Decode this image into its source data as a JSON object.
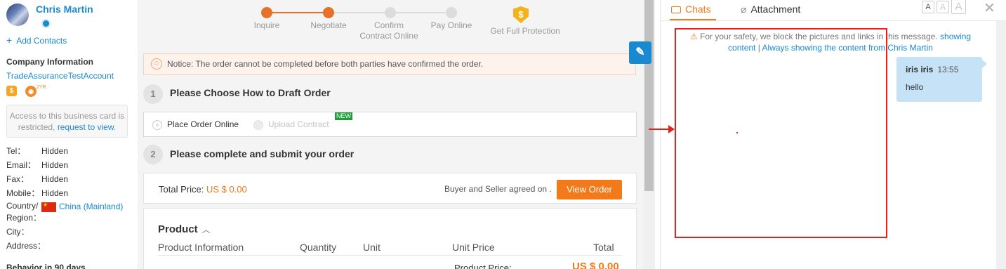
{
  "contact": {
    "name": "Chris Martin",
    "add_contacts": "Add Contacts",
    "company_heading": "Company Information",
    "company_name": "TradeAssuranceTestAccount",
    "years_badge": "2YR",
    "restricted_text": "Access to this business card is restricted,",
    "restricted_link": "request to view",
    "restricted_end": ".",
    "fields": [
      {
        "key": "Tel：",
        "value": "Hidden"
      },
      {
        "key": "Email：",
        "value": "Hidden"
      },
      {
        "key": "Fax：",
        "value": "Hidden"
      },
      {
        "key": "Mobile：",
        "value": "Hidden"
      }
    ],
    "country_key_1": "Country/",
    "country_key_2": "Region：",
    "country_value": "China (Mainland)",
    "city_key": "City：",
    "address_key": "Address：",
    "behavior": "Behavior in 90 days"
  },
  "steps": [
    {
      "label": "Inquire",
      "state": "done"
    },
    {
      "label": "Negotiate",
      "state": "done"
    },
    {
      "label": "Confirm\nContract Online",
      "state": "todo"
    },
    {
      "label": "Pay Online",
      "state": "todo"
    },
    {
      "label": "Get Full Protection",
      "state": "todo"
    }
  ],
  "shield_symbol": "$",
  "notice": "Notice: The order cannot be completed before both parties have confirmed the order.",
  "section1": {
    "num": "1",
    "title": "Please Choose How to Draft Order"
  },
  "draft_options": {
    "online": "Place Order Online",
    "upload": "Upload Contract",
    "new_badge": "NEW"
  },
  "section2": {
    "num": "2",
    "title": "Please complete and submit your order"
  },
  "price": {
    "total_label": "Total Price:",
    "total_value": "US $ 0.00",
    "agreed": "Buyer and Seller agreed on .",
    "view_order": "View Order"
  },
  "product": {
    "title": "Product",
    "columns": [
      "Product Information",
      "Quantity",
      "Unit",
      "Unit Price",
      "Total"
    ],
    "product_price_label": "Product Price:",
    "product_price_value": "US $ 0.00"
  },
  "chat": {
    "tab_chats": "Chats",
    "tab_attachment": "Attachment",
    "font_sizes": [
      "A",
      "A",
      "A"
    ],
    "safety_text": "For your safety, we block the pictures and links in this message.",
    "showing_content": "showing content",
    "always_show": "Always showing the content from Chris Martin",
    "separator": "|",
    "message": {
      "sender": "iris iris",
      "time": "13:55",
      "text": "hello"
    }
  },
  "colors": {
    "accent": "#f27a1a",
    "link": "#1a8ad0",
    "annotation": "#e0241b"
  }
}
